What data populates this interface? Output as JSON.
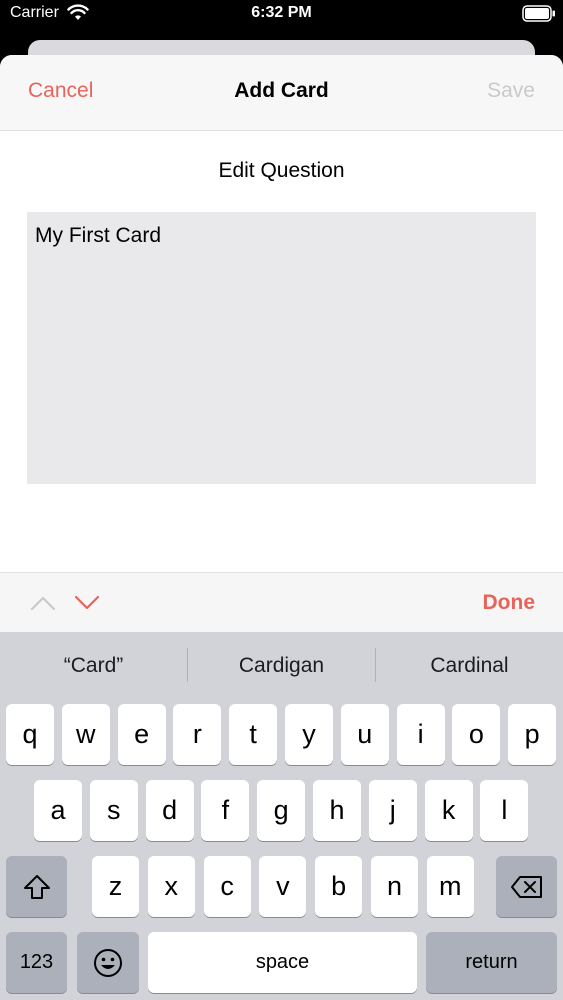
{
  "status": {
    "carrier": "Carrier",
    "time": "6:32 PM"
  },
  "nav": {
    "cancel": "Cancel",
    "title": "Add Card",
    "save": "Save"
  },
  "form": {
    "section_label": "Edit Question",
    "question_value": "My First Card"
  },
  "accessory": {
    "done": "Done"
  },
  "keyboard": {
    "suggestions": [
      "“Card”",
      "Cardigan",
      "Cardinal"
    ],
    "row1": [
      "q",
      "w",
      "e",
      "r",
      "t",
      "y",
      "u",
      "i",
      "o",
      "p"
    ],
    "row2": [
      "a",
      "s",
      "d",
      "f",
      "g",
      "h",
      "j",
      "k",
      "l"
    ],
    "row3": [
      "z",
      "x",
      "c",
      "v",
      "b",
      "n",
      "m"
    ],
    "numbers_key": "123",
    "space_key": "space",
    "return_key": "return",
    "shift_icon": "shift-icon",
    "delete_icon": "delete-icon",
    "emoji_icon": "emoji-icon"
  },
  "colors": {
    "accent": "#e8645a",
    "disabled": "#c9c9cc",
    "keyboard_bg": "#d1d3d9"
  }
}
